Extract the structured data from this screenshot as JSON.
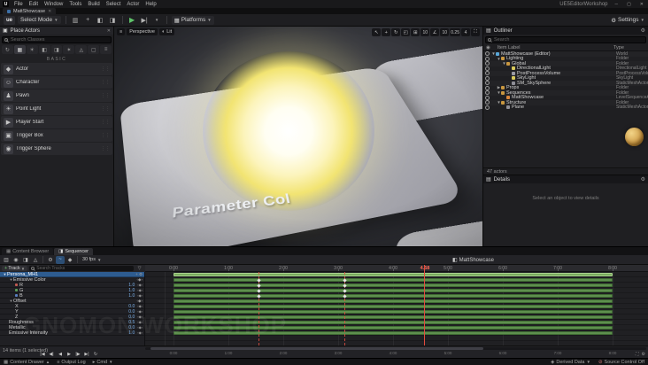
{
  "window": {
    "menus": [
      "File",
      "Edit",
      "Window",
      "Tools",
      "Build",
      "Select",
      "Actor",
      "Help"
    ],
    "app_title": "UE5EditorWorkshop",
    "asset_tab": "MattShowcase"
  },
  "toolbar": {
    "select_mode": "Select Mode",
    "platforms": "Platforms",
    "settings": "Settings"
  },
  "place_actors": {
    "title": "Place Actors",
    "search_placeholder": "Search Classes",
    "category_label": "BASIC",
    "items": [
      "Actor",
      "Character",
      "Pawn",
      "Point Light",
      "Player Start",
      "Trigger Box",
      "Trigger Sphere"
    ]
  },
  "viewport": {
    "perspective": "Perspective",
    "lit": "Lit",
    "grid_snap": "10",
    "rotation_snap": "10",
    "scale_snap": "0.25",
    "camera_speed": "4",
    "text_3d": "Parameter Col"
  },
  "outliner": {
    "title": "Outliner",
    "search_placeholder": "Search",
    "col_label": "Item Label",
    "col_type": "Type",
    "footer": "47 actors",
    "rows": [
      {
        "label": "MattShowcase (Editor)",
        "type": "World"
      },
      {
        "label": "Lighting",
        "type": "Folder"
      },
      {
        "label": "Global",
        "type": "Folder"
      },
      {
        "label": "DirectionalLight",
        "type": "DirectionalLight"
      },
      {
        "label": "PostProcessVolume",
        "type": "PostProcessVolume"
      },
      {
        "label": "SkyLight",
        "type": "SkyLight"
      },
      {
        "label": "SM_SkySphere",
        "type": "StaticMeshActor"
      },
      {
        "label": "Props",
        "type": "Folder"
      },
      {
        "label": "Sequences",
        "type": "Folder"
      },
      {
        "label": "MattShowcase",
        "type": "LevelSequenceActor"
      },
      {
        "label": "Structure",
        "type": "Folder"
      },
      {
        "label": "Plane",
        "type": "StaticMeshActor"
      }
    ]
  },
  "details": {
    "title": "Details",
    "empty": "Select an object to view details"
  },
  "sequencer": {
    "tab_content_browser": "Content Browser",
    "tab_sequencer": "Sequencer",
    "fps": "30 fps",
    "sequence_name": "MattShowcase",
    "add_track": "Track",
    "search_placeholder": "Search Tracks",
    "playhead": "4.58",
    "footer": "14 items (1 selected)",
    "ruler": [
      "0:00",
      "1:00",
      "2:00",
      "3:00",
      "4:00",
      "5:00",
      "6:00",
      "7:00",
      "8:00"
    ],
    "transport": [
      "|◀",
      "◀|",
      "◀",
      "▶",
      "|▶",
      "▶|",
      "↻"
    ],
    "tracks": [
      {
        "label": "Persona_MH1"
      },
      {
        "label": "Emissive Color"
      },
      {
        "label": "R",
        "value": "1.0"
      },
      {
        "label": "G",
        "value": "1.0"
      },
      {
        "label": "B",
        "value": "1.0"
      },
      {
        "label": "Offset"
      },
      {
        "label": "X",
        "value": "0.0"
      },
      {
        "label": "Y",
        "value": "0.0"
      },
      {
        "label": "Z",
        "value": "0.0"
      },
      {
        "label": "Roughness",
        "value": "0.5"
      },
      {
        "label": "Metallic",
        "value": "0.0"
      },
      {
        "label": "Emissive Intensity",
        "value": "1.0"
      }
    ]
  },
  "statusbar": {
    "content_drawer": "Content Drawer",
    "output_log": "Output Log",
    "cmd": "Cmd",
    "derived_data": "Derived Data",
    "source_control": "Source Control Off"
  },
  "watermark": {
    "text": "GNOMON WORKSHOP"
  },
  "colors": {
    "selection_blue": "#2e5c90",
    "section_green": "#5e8f4e",
    "playhead_red": "#e44b3d",
    "glow_yellow": "#f2e472"
  }
}
